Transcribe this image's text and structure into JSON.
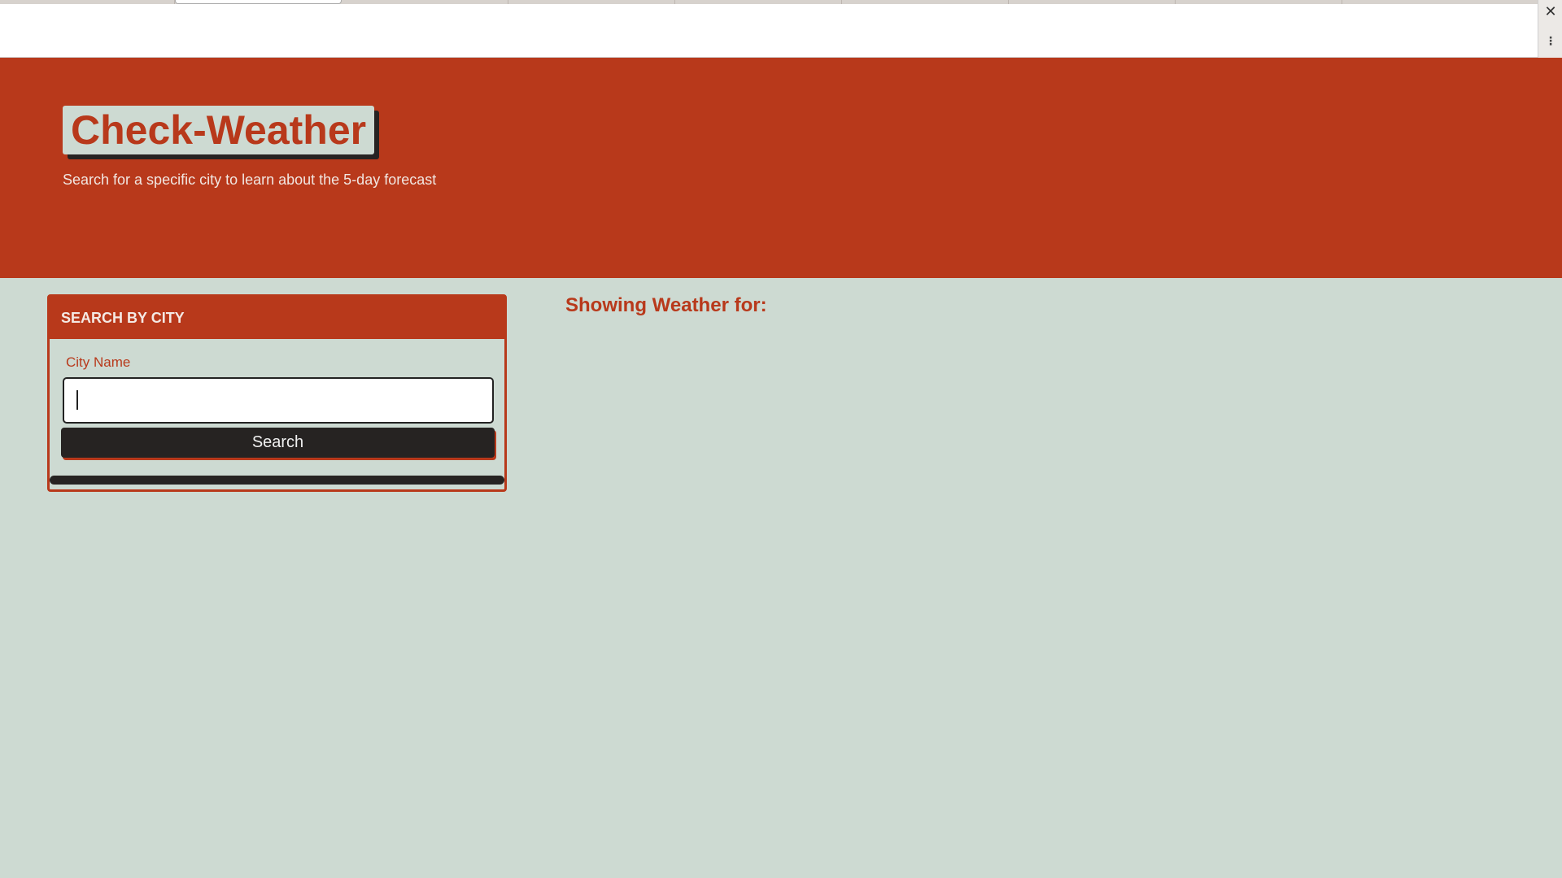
{
  "window": {
    "close_glyph": "✕",
    "menu_glyph": "⋮"
  },
  "header": {
    "brand": "Check-Weather",
    "tagline": "Search for a specific city to learn about the 5-day forecast"
  },
  "search": {
    "card_title": "SEARCH BY CITY",
    "label": "City Name",
    "input_value": "",
    "placeholder": "",
    "button_label": "Search"
  },
  "results": {
    "heading": "Showing Weather for:"
  },
  "colors": {
    "accent": "#b8391b",
    "background": "#cddad2",
    "dark": "#262322"
  }
}
